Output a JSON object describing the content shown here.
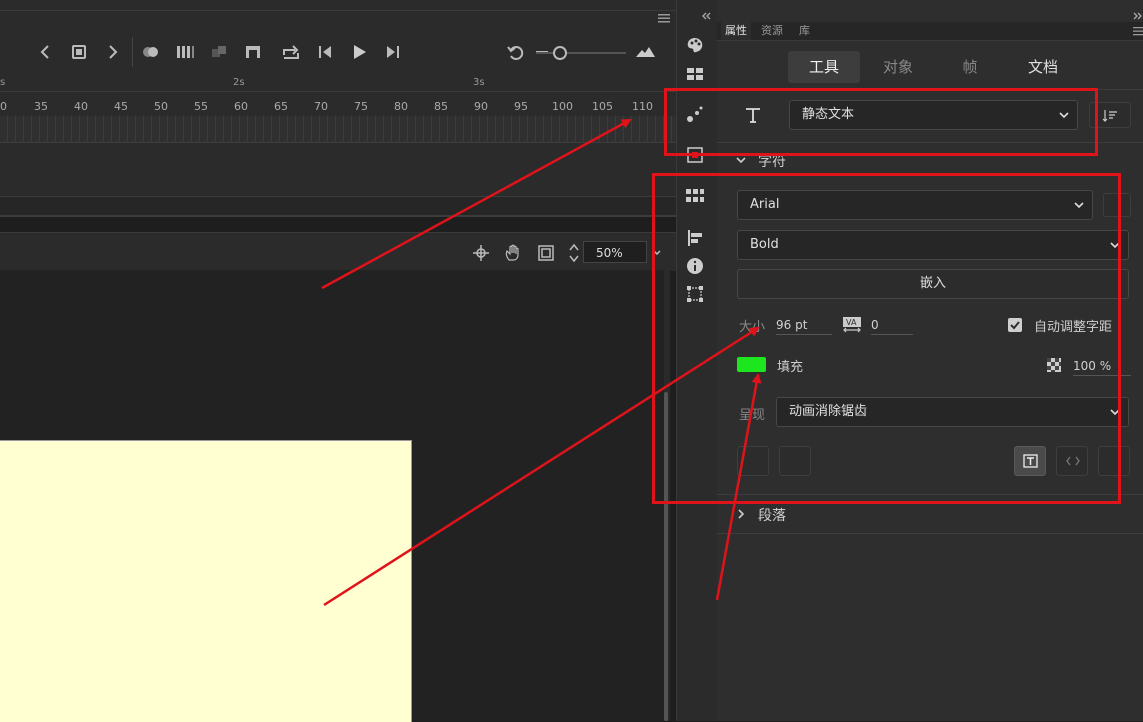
{
  "timeline": {
    "seconds": [
      "s",
      "2s",
      "3s"
    ],
    "frames": [
      "0",
      "35",
      "40",
      "45",
      "50",
      "55",
      "60",
      "65",
      "70",
      "75",
      "80",
      "85",
      "90",
      "95",
      "100",
      "105",
      "110"
    ],
    "zoom_value": "50%"
  },
  "panel": {
    "tabs": [
      "属性",
      "资源",
      "库"
    ],
    "subtabs": [
      "工具",
      "对象",
      "帧",
      "文档"
    ],
    "text_type": "静态文本",
    "section_character": "字符",
    "font_family": "Arial",
    "font_style": "Bold",
    "embed_label": "嵌入",
    "size_label": "大小",
    "size_value": "96 pt",
    "tracking_value": "0",
    "auto_kern_label": "自动调整字距",
    "fill_label": "填充",
    "fill_color": "#1ee61e",
    "fill_alpha": "100 %",
    "render_label": "呈现",
    "render_value": "动画消除锯齿",
    "section_paragraph": "段落"
  },
  "colors": {
    "highlight": "#e0131a",
    "canvas": "#ffffd2"
  }
}
